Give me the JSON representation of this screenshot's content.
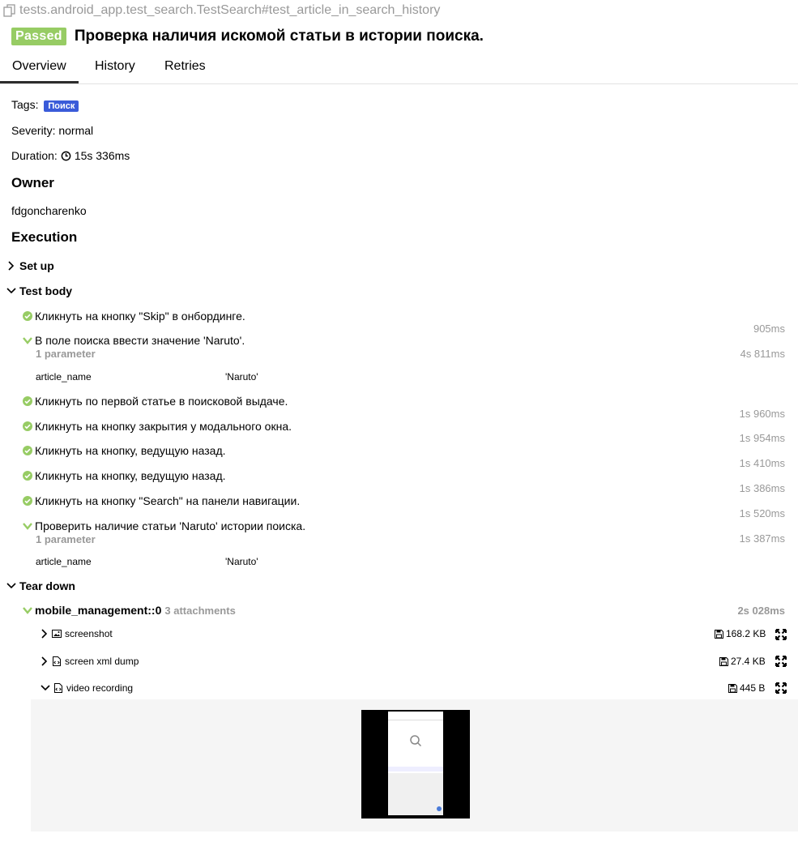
{
  "header": {
    "test_path": "tests.android_app.test_search.TestSearch#test_article_in_search_history",
    "status": "Passed",
    "title": "Проверка наличия искомой статьи в истории поиска."
  },
  "tabs": [
    "Overview",
    "History",
    "Retries"
  ],
  "meta": {
    "tags_label": "Tags:",
    "tag": "Поиск",
    "severity": "Severity: normal",
    "duration_label": "Duration:",
    "duration": "15s 336ms"
  },
  "owner": {
    "heading": "Owner",
    "name": "fdgoncharenko"
  },
  "execution": {
    "heading": "Execution",
    "setup": "Set up",
    "body": "Test body",
    "teardown": "Tear down",
    "steps": [
      {
        "text": "Кликнуть на кнопку \"Skip\" в онбординге.",
        "duration": "905ms"
      },
      {
        "text": "В поле поиска ввести значение 'Naruto'.",
        "duration": "4s 811ms",
        "params": "1 parameter",
        "pname": "article_name",
        "pval": "'Naruto'"
      },
      {
        "text": "Кликнуть по первой статье в поисковой выдаче.",
        "duration": "1s 960ms"
      },
      {
        "text": "Кликнуть на кнопку закрытия у модального окна.",
        "duration": "1s 954ms"
      },
      {
        "text": "Кликнуть на кнопку, ведущую назад.",
        "duration": "1s 410ms"
      },
      {
        "text": "Кликнуть на кнопку, ведущую назад.",
        "duration": "1s 386ms"
      },
      {
        "text": "Кликнуть на кнопку \"Search\" на панели навигации.",
        "duration": "1s 520ms"
      },
      {
        "text": "Проверить наличие статьи 'Naruto' истории поиска.",
        "duration": "1s 387ms",
        "params": "1 parameter",
        "pname": "article_name",
        "pval": "'Naruto'"
      }
    ],
    "fixture": {
      "name": "mobile_management::0",
      "attachments_count": "3 attachments",
      "duration": "2s 028ms",
      "attachments": [
        {
          "name": "screenshot",
          "size": "168.2 KB"
        },
        {
          "name": "screen xml dump",
          "size": "27.4 KB"
        },
        {
          "name": "video recording",
          "size": "445 B"
        }
      ]
    }
  },
  "colors": {
    "passed": "#97cc64",
    "tag": "#3a5bd9",
    "muted": "#999999"
  }
}
